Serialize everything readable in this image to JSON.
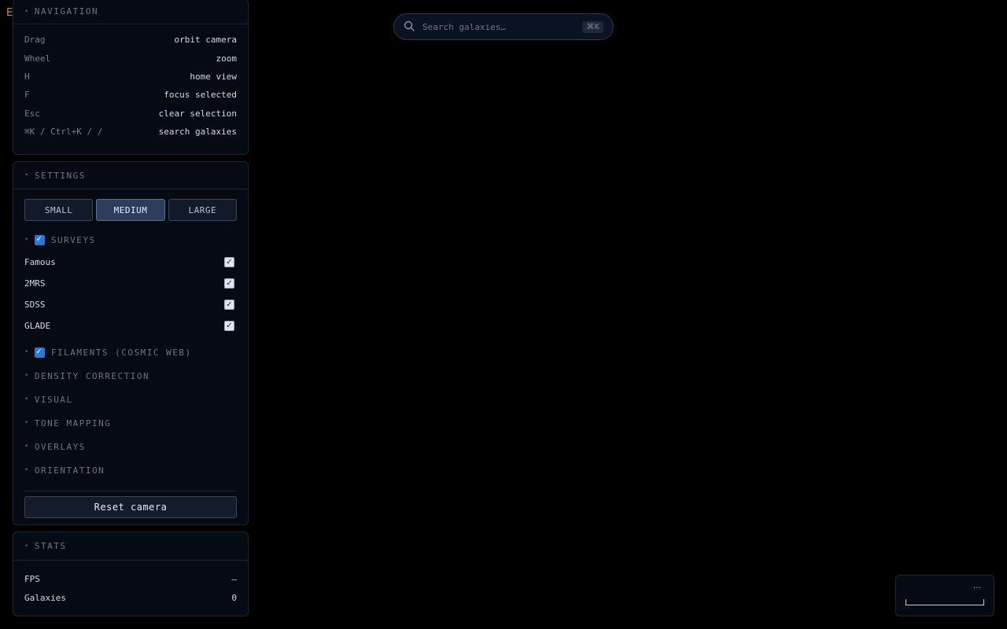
{
  "stray_text": "E",
  "navigation": {
    "title": "NAVIGATION",
    "rows": [
      {
        "key": "Drag",
        "action": "orbit camera"
      },
      {
        "key": "Wheel",
        "action": "zoom"
      },
      {
        "key": "H",
        "action": "home view"
      },
      {
        "key": "F",
        "action": "focus selected"
      },
      {
        "key": "Esc",
        "action": "clear selection"
      },
      {
        "key": "⌘K / Ctrl+K / /",
        "action": "search galaxies"
      }
    ]
  },
  "settings": {
    "title": "SETTINGS",
    "sizes": [
      "SMALL",
      "MEDIUM",
      "LARGE"
    ],
    "active_size": "MEDIUM",
    "surveys": {
      "title": "SURVEYS",
      "checked": true,
      "items": [
        {
          "label": "Famous",
          "checked": true
        },
        {
          "label": "2MRS",
          "checked": true
        },
        {
          "label": "SDSS",
          "checked": true
        },
        {
          "label": "GLADE",
          "checked": true
        }
      ]
    },
    "filaments": {
      "title": "FILAMENTS (COSMIC WEB)",
      "checked": true
    },
    "sections": [
      "DENSITY CORRECTION",
      "VISUAL",
      "TONE MAPPING",
      "OVERLAYS",
      "ORIENTATION"
    ],
    "reset_label": "Reset camera"
  },
  "stats": {
    "title": "STATS",
    "rows": [
      {
        "label": "FPS",
        "value": "—"
      },
      {
        "label": "Galaxies",
        "value": "0"
      }
    ]
  },
  "search": {
    "placeholder": "Search galaxies…",
    "value": "",
    "shortcut": "⌘K",
    "icon": "search-icon"
  },
  "minimap": {
    "ellipsis": "…"
  },
  "colors": {
    "background": "#000000",
    "panel": "#060a12",
    "border": "#1e2636",
    "checkbox_accent": "#2979d9",
    "active_button": "#2c3d5e"
  }
}
